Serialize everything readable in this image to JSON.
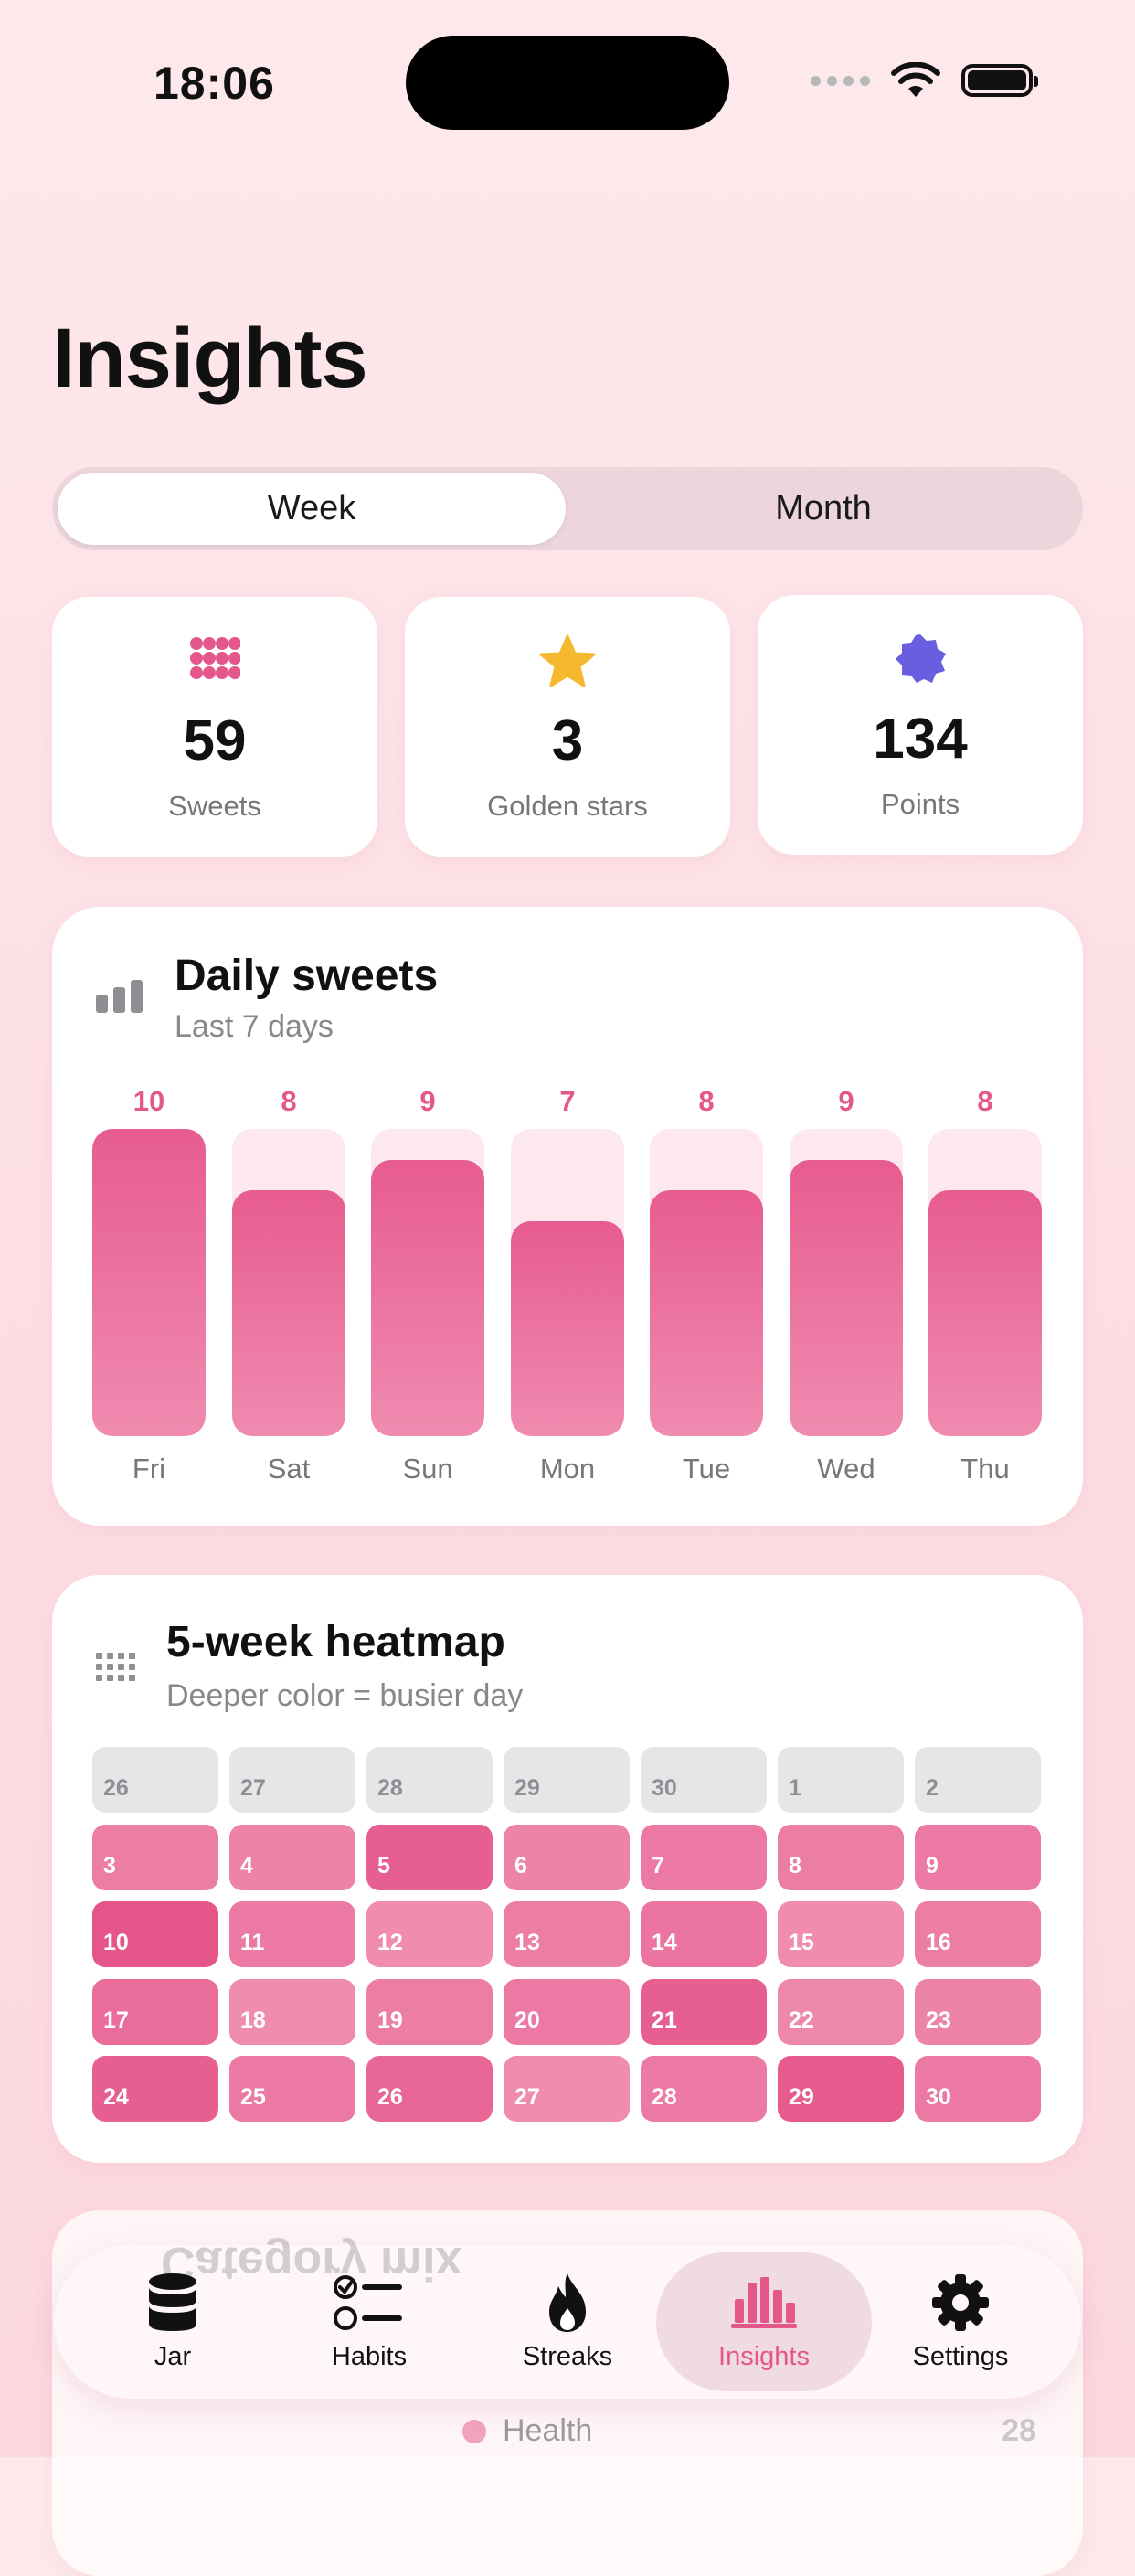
{
  "status_bar": {
    "time": "18:06"
  },
  "header": {
    "title": "Insights"
  },
  "segmented": {
    "week_label": "Week",
    "month_label": "Month",
    "selected": "Week"
  },
  "stats": [
    {
      "value": "59",
      "label": "Sweets",
      "icon": "dots-grid-icon",
      "color": "#e4578a"
    },
    {
      "value": "3",
      "label": "Golden stars",
      "icon": "star-icon",
      "color": "#f5b82e"
    },
    {
      "value": "134",
      "label": "Points",
      "icon": "badge-icon",
      "color": "#6a5ee0"
    }
  ],
  "daily_card": {
    "title": "Daily sweets",
    "subtitle": "Last 7 days",
    "icon": "bar-chart-icon"
  },
  "chart_data": {
    "type": "bar",
    "categories": [
      "Fri",
      "Sat",
      "Sun",
      "Mon",
      "Tue",
      "Wed",
      "Thu"
    ],
    "values": [
      10,
      8,
      9,
      7,
      8,
      9,
      8
    ],
    "ylim": [
      0,
      10
    ],
    "title": "Daily sweets",
    "subtitle": "Last 7 days"
  },
  "heatmap_card": {
    "title": "5-week heatmap",
    "subtitle": "Deeper color = busier day",
    "icon": "grid-icon",
    "weeks": [
      [
        {
          "d": "26",
          "i": 0
        },
        {
          "d": "27",
          "i": 0
        },
        {
          "d": "28",
          "i": 0
        },
        {
          "d": "29",
          "i": 0
        },
        {
          "d": "30",
          "i": 0
        },
        {
          "d": "1",
          "i": 0
        },
        {
          "d": "2",
          "i": 0
        }
      ],
      [
        {
          "d": "3",
          "i": 0.55
        },
        {
          "d": "4",
          "i": 0.5
        },
        {
          "d": "5",
          "i": 0.9
        },
        {
          "d": "6",
          "i": 0.5
        },
        {
          "d": "7",
          "i": 0.6
        },
        {
          "d": "8",
          "i": 0.55
        },
        {
          "d": "9",
          "i": 0.6
        }
      ],
      [
        {
          "d": "10",
          "i": 1.0
        },
        {
          "d": "11",
          "i": 0.6
        },
        {
          "d": "12",
          "i": 0.4
        },
        {
          "d": "13",
          "i": 0.55
        },
        {
          "d": "14",
          "i": 0.65
        },
        {
          "d": "15",
          "i": 0.4
        },
        {
          "d": "16",
          "i": 0.55
        }
      ],
      [
        {
          "d": "17",
          "i": 0.75
        },
        {
          "d": "18",
          "i": 0.4
        },
        {
          "d": "19",
          "i": 0.55
        },
        {
          "d": "20",
          "i": 0.6
        },
        {
          "d": "21",
          "i": 0.9
        },
        {
          "d": "22",
          "i": 0.45
        },
        {
          "d": "23",
          "i": 0.5
        }
      ],
      [
        {
          "d": "24",
          "i": 0.9
        },
        {
          "d": "25",
          "i": 0.6
        },
        {
          "d": "26",
          "i": 0.8
        },
        {
          "d": "27",
          "i": 0.4
        },
        {
          "d": "28",
          "i": 0.6
        },
        {
          "d": "29",
          "i": 0.95
        },
        {
          "d": "30",
          "i": 0.6
        }
      ]
    ]
  },
  "category_card": {
    "ghost_title": "Category mix",
    "legend_label": "Health",
    "legend_count": "28"
  },
  "tab_bar": {
    "items": [
      {
        "label": "Jar",
        "icon": "jar-icon",
        "active": false
      },
      {
        "label": "Habits",
        "icon": "checklist-icon",
        "active": false
      },
      {
        "label": "Streaks",
        "icon": "flame-icon",
        "active": false
      },
      {
        "label": "Insights",
        "icon": "bar-chart-icon",
        "active": true
      },
      {
        "label": "Settings",
        "icon": "gear-icon",
        "active": false
      }
    ]
  },
  "colors": {
    "accent": "#e4578a",
    "bar_track": "#fde8ee",
    "empty_cell": "#e6e6e9"
  }
}
